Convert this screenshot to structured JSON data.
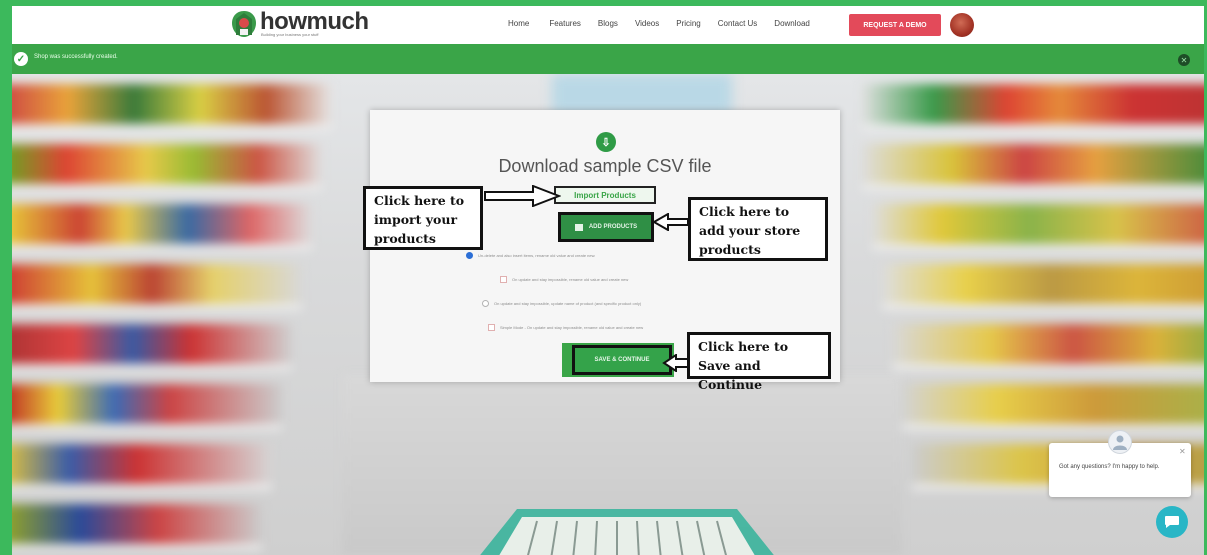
{
  "navbar": {
    "brand": "howmuch",
    "tagline": "Building your business your stuff",
    "menu": [
      "Home",
      "Features",
      "Blogs",
      "Videos",
      "Pricing",
      "Contact Us",
      "Download"
    ],
    "demo_button": "REQUEST A DEMO"
  },
  "notification": {
    "message": "Shop was successfully created."
  },
  "modal": {
    "title": "Download sample CSV file",
    "import_link": "Import Products",
    "add_products_button": "ADD PRODUCTS",
    "options": [
      "Un-delete and also insert items, rename old value and create new.",
      "On update and stay impossible, rename old value and create new",
      "On update and stay impossible, update name of product (and specific product only)",
      "Simple Mode - On update and stay impossible, rename old value and create new"
    ],
    "save_button": "SAVE & CONTINUE"
  },
  "callouts": {
    "import": "Click here to import your products",
    "add": "Click here to add your store products",
    "save": "Click here to Save and Continue"
  },
  "chat": {
    "message": "Got any questions? I'm happy to help."
  },
  "colors": {
    "border_green": "#3cb95c",
    "success_green": "#3aa548",
    "demo_red": "#e34a5a",
    "chat_teal": "#29b6c6"
  }
}
